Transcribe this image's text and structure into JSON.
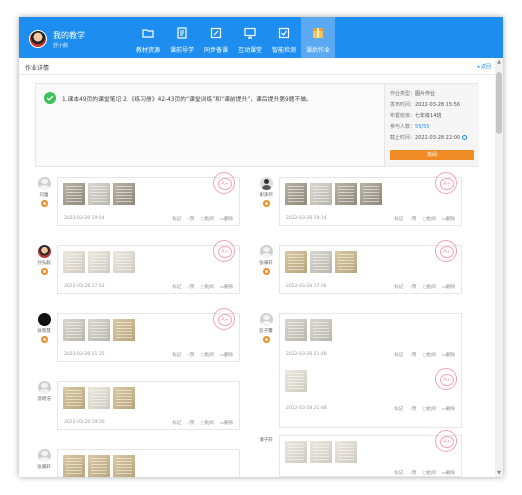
{
  "header": {
    "title": "我的教学",
    "subtitle": "舒小鹅",
    "nav": [
      {
        "label": "教材资源",
        "icon": "folder-icon"
      },
      {
        "label": "课前导学",
        "icon": "document-icon"
      },
      {
        "label": "同步备课",
        "icon": "edit-icon"
      },
      {
        "label": "互动课堂",
        "icon": "monitor-icon"
      },
      {
        "label": "智能检测",
        "icon": "checklist-icon"
      },
      {
        "label": "课后作业",
        "icon": "homework-box-icon"
      }
    ]
  },
  "subhead": {
    "crumb": "作业详情",
    "back": "返回"
  },
  "assignment": {
    "description": "1.课本49页的课堂笔记 2.《练习册》42-43页的“课堂训练”和“课前提升”，课后提升第9题不做。",
    "info": {
      "type_label": "作业类型：",
      "type_value": "图片作业",
      "published_label": "发布时间：",
      "published_value": "2022-03-28 15:56",
      "class_label": "布置班级：",
      "class_value": "七年级14班",
      "participants_label": "参与人数：",
      "participants_value": "55/55",
      "deadline_label": "截止时间：",
      "deadline_value": "2022-03-28 22:00",
      "button": "批阅"
    }
  },
  "actions": {
    "mark": "标记",
    "like": "赞",
    "review": "批阅",
    "delete": "删除"
  },
  "submissions": [
    {
      "name": "刘蕾",
      "time": "2022-03-28 19:04",
      "avatar": "default"
    },
    {
      "name": "谢泽邦",
      "time": "2022-03-28 19:14",
      "avatar": "tie"
    },
    {
      "name": "孙弘毅",
      "time": "2022-03-28 17:02",
      "avatar": "photo"
    },
    {
      "name": "张谦轩",
      "time": "2022-03-28 17:06",
      "avatar": "default"
    },
    {
      "name": "徐晓慧",
      "time": "2022-03-28 21:35",
      "avatar": "dark"
    },
    {
      "name": "彭子馨",
      "time": "2022-03-28 21:48",
      "avatar": "default"
    },
    {
      "name": "",
      "time": "2022-03-28 21:48",
      "avatar": "none"
    },
    {
      "name": "温明浩",
      "time": "2022-03-28 19:00",
      "avatar": "default"
    },
    {
      "name": "张瀚轩",
      "time": "",
      "avatar": "default"
    },
    {
      "name": "潘子轩",
      "time": "",
      "avatar": "none"
    }
  ]
}
